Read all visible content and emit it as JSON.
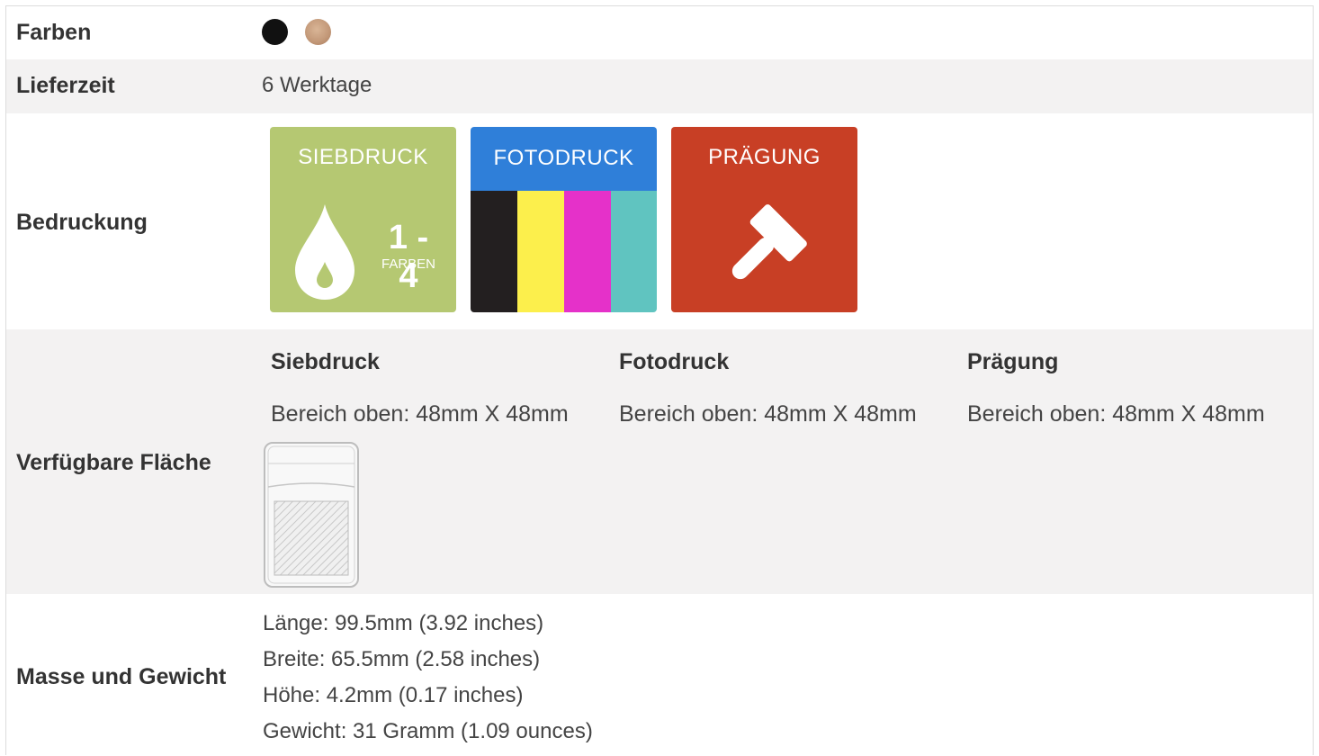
{
  "rows": {
    "farben": {
      "label": "Farben",
      "swatches": [
        {
          "name": "schwarz",
          "color": "#111111"
        },
        {
          "name": "gold",
          "color": "#c49a7a"
        }
      ]
    },
    "lieferzeit": {
      "label": "Lieferzeit",
      "value": "6 Werktage"
    },
    "bedruckung": {
      "label": "Bedruckung",
      "tiles": [
        {
          "title": "SIEBDRUCK",
          "count": "1 - 4",
          "unit": "FARBEN",
          "color": "#b5c872",
          "icon": "ink-drop-icon"
        },
        {
          "title": "FOTODRUCK",
          "color": "#2f7fd9",
          "stripes": [
            "#231f20",
            "#fcef4c",
            "#e531c9",
            "#60c4c0"
          ]
        },
        {
          "title": "PRÄGUNG",
          "color": "#c83f25",
          "icon": "hammer-icon"
        }
      ]
    },
    "flaeche": {
      "label": "Verfügbare Fläche",
      "methods": [
        {
          "heading": "Siebdruck",
          "area": "Bereich oben: 48mm X 48mm"
        },
        {
          "heading": "Fotodruck",
          "area": "Bereich oben: 48mm X 48mm"
        },
        {
          "heading": "Prägung",
          "area": "Bereich oben: 48mm X 48mm"
        }
      ]
    },
    "masse": {
      "label": "Masse und Gewicht",
      "lines": [
        "Länge: 99.5mm (3.92 inches)",
        "Breite: 65.5mm (2.58 inches)",
        "Höhe: 4.2mm (0.17 inches)",
        "Gewicht: 31 Gramm (1.09 ounces)"
      ]
    }
  },
  "colors": {
    "row_alt_bg": "#f3f2f2",
    "border": "#dcdcdc"
  }
}
